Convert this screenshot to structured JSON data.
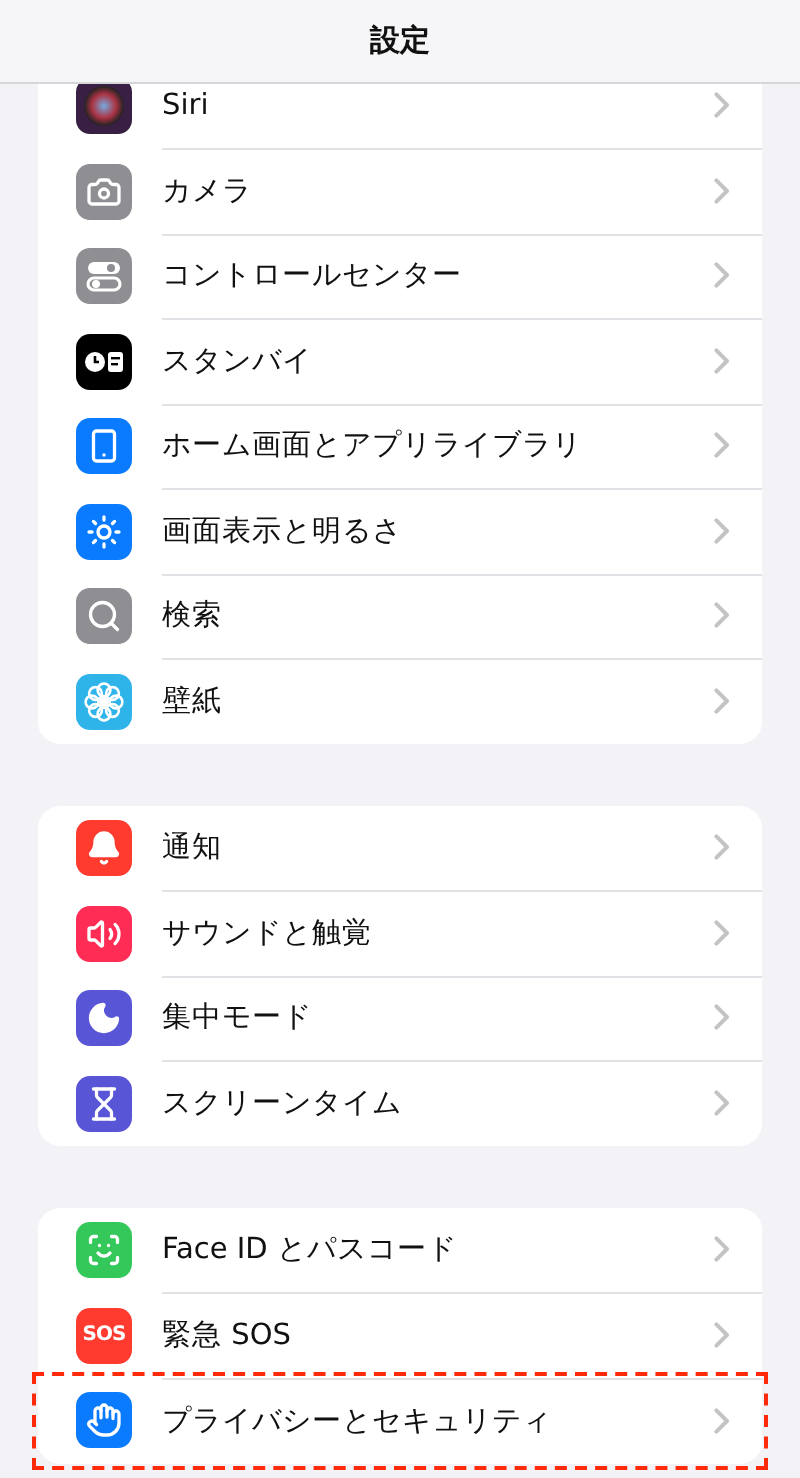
{
  "header": {
    "title": "設定"
  },
  "groups": [
    {
      "items": [
        {
          "label": "Siri",
          "kind": "siri",
          "highlighted": false
        },
        {
          "label": "カメラ",
          "kind": "camera",
          "highlighted": false
        },
        {
          "label": "コントロールセンター",
          "kind": "toggles",
          "highlighted": false
        },
        {
          "label": "スタンバイ",
          "kind": "standby",
          "highlighted": false
        },
        {
          "label": "ホーム画面とアプリライブラリ",
          "kind": "phone",
          "highlighted": false
        },
        {
          "label": "画面表示と明るさ",
          "kind": "sun",
          "highlighted": false
        },
        {
          "label": "検索",
          "kind": "search",
          "highlighted": false
        },
        {
          "label": "壁紙",
          "kind": "flower",
          "highlighted": false
        }
      ]
    },
    {
      "items": [
        {
          "label": "通知",
          "kind": "bell",
          "highlighted": false
        },
        {
          "label": "サウンドと触覚",
          "kind": "speaker",
          "highlighted": false
        },
        {
          "label": "集中モード",
          "kind": "moon",
          "highlighted": false
        },
        {
          "label": "スクリーンタイム",
          "kind": "hourglass",
          "highlighted": false
        }
      ]
    },
    {
      "items": [
        {
          "label": "Face ID とパスコード",
          "kind": "face",
          "highlighted": false
        },
        {
          "label": "緊急 SOS",
          "kind": "sos",
          "badge": "SOS",
          "highlighted": false
        },
        {
          "label": "プライバシーとセキュリティ",
          "kind": "hand",
          "highlighted": true
        }
      ]
    }
  ]
}
